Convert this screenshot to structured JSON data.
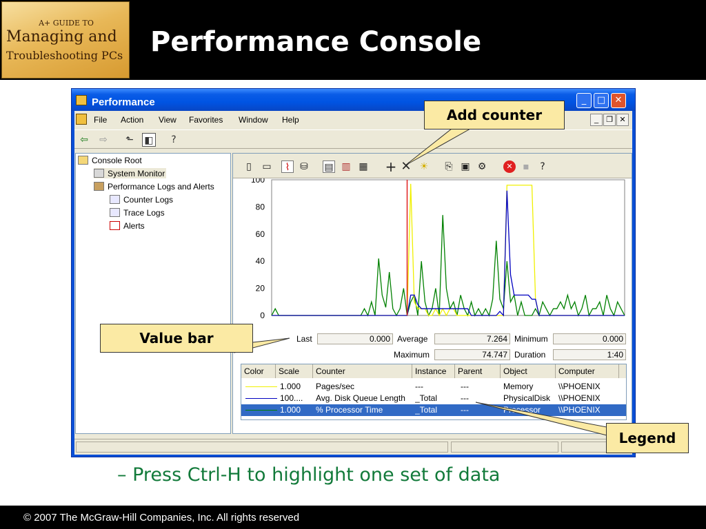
{
  "slide": {
    "title": "Performance Console",
    "logo": {
      "line1": "A+ GUIDE TO",
      "line2": "Managing and",
      "line3": "Troubleshooting PCs"
    },
    "bullet": "– Press Ctrl-H to highlight one set of data",
    "footer": "© 2007 The McGraw-Hill Companies, Inc. All rights reserved"
  },
  "window": {
    "title": "Performance",
    "menu": [
      "File",
      "Action",
      "View",
      "Favorites",
      "Window",
      "Help"
    ]
  },
  "tree": {
    "items": [
      {
        "label": "Console Root",
        "icon": "folder-icon"
      },
      {
        "label": "System Monitor",
        "icon": "monitor-icon"
      },
      {
        "label": "Performance Logs and Alerts",
        "icon": "logs-icon"
      },
      {
        "label": "Counter Logs",
        "icon": "counter-log-icon"
      },
      {
        "label": "Trace Logs",
        "icon": "trace-log-icon"
      },
      {
        "label": "Alerts",
        "icon": "alert-icon"
      }
    ]
  },
  "value_bar": {
    "last_label": "Last",
    "last": "0.000",
    "average_label": "Average",
    "average": "7.264",
    "minimum_label": "Minimum",
    "minimum": "0.000",
    "maximum_label": "Maximum",
    "maximum": "74.747",
    "duration_label": "Duration",
    "duration": "1:40"
  },
  "legend": {
    "columns": [
      "Color",
      "Scale",
      "Counter",
      "Instance",
      "Parent",
      "Object",
      "Computer"
    ],
    "rows": [
      {
        "color": "#f0f000",
        "scale": "1.000",
        "counter": "Pages/sec",
        "instance": "---",
        "parent": "---",
        "object": "Memory",
        "computer": "\\\\PHOENIX"
      },
      {
        "color": "#0000c0",
        "scale": "100....",
        "counter": "Avg. Disk Queue Length",
        "instance": "_Total",
        "parent": "---",
        "object": "PhysicalDisk",
        "computer": "\\\\PHOENIX"
      },
      {
        "color": "#008000",
        "scale": "1.000",
        "counter": "% Processor Time",
        "instance": "_Total",
        "parent": "---",
        "object": "Processor",
        "computer": "\\\\PHOENIX"
      }
    ]
  },
  "callouts": {
    "add_counter": "Add counter",
    "value_bar": "Value bar",
    "legend": "Legend"
  },
  "chart_data": {
    "type": "line",
    "ylim": [
      0,
      100
    ],
    "yticks": [
      0,
      20,
      40,
      60,
      80,
      100
    ],
    "x": [
      0,
      1,
      2,
      3,
      4,
      5,
      6,
      7,
      8,
      9,
      10,
      11,
      12,
      13,
      14,
      15,
      16,
      17,
      18,
      19,
      20,
      21,
      22,
      23,
      24,
      25,
      26,
      27,
      28,
      29,
      30,
      31,
      32,
      33,
      34,
      35,
      36,
      37,
      38,
      39,
      40,
      41,
      42,
      43,
      44,
      45,
      46,
      47,
      48,
      49,
      50,
      51,
      52,
      53,
      54,
      55,
      56,
      57,
      58,
      59,
      60,
      61,
      62,
      63,
      64,
      65,
      66,
      67,
      68,
      69,
      70,
      71,
      72,
      73,
      74,
      75,
      76,
      77,
      78,
      79,
      80,
      81,
      82,
      83,
      84,
      85,
      86,
      87,
      88,
      89,
      90,
      91,
      92,
      93,
      94,
      95,
      96,
      97,
      98,
      99
    ],
    "current_x": 38,
    "series": [
      {
        "color": "#008000",
        "values": [
          0,
          5,
          0,
          0,
          0,
          0,
          0,
          0,
          0,
          0,
          0,
          0,
          0,
          0,
          0,
          0,
          0,
          0,
          0,
          0,
          0,
          0,
          0,
          0,
          0,
          0,
          5,
          0,
          10,
          0,
          42,
          15,
          6,
          32,
          5,
          0,
          5,
          20,
          0,
          10,
          15,
          0,
          40,
          10,
          0,
          5,
          20,
          0,
          74,
          20,
          5,
          10,
          0,
          15,
          5,
          0,
          10,
          0,
          5,
          0,
          5,
          0,
          12,
          55,
          12,
          5,
          40,
          10,
          15,
          0,
          10,
          0,
          0,
          0,
          5,
          0,
          10,
          5,
          0,
          5,
          5,
          10,
          5,
          15,
          5,
          10,
          0,
          5,
          15,
          0,
          5,
          5,
          10,
          0,
          15,
          5,
          0,
          10,
          5,
          0
        ]
      },
      {
        "color": "#f0f000",
        "values": [
          0,
          0,
          0,
          0,
          0,
          0,
          0,
          0,
          0,
          0,
          0,
          0,
          0,
          0,
          0,
          0,
          0,
          0,
          0,
          0,
          0,
          0,
          0,
          0,
          0,
          0,
          0,
          0,
          0,
          0,
          0,
          0,
          0,
          0,
          0,
          0,
          0,
          0,
          0,
          97,
          10,
          5,
          5,
          5,
          0,
          0,
          5,
          0,
          5,
          0,
          5,
          5,
          0,
          0,
          0,
          0,
          0,
          0,
          0,
          0,
          0,
          0,
          0,
          0,
          0,
          0,
          96,
          96,
          96,
          96,
          96,
          96,
          96,
          96,
          12,
          0,
          0,
          0,
          0,
          0,
          0,
          0,
          0,
          0,
          0,
          0,
          0,
          0,
          0,
          0,
          0,
          0,
          0,
          0,
          0,
          0,
          0,
          0,
          0,
          0
        ]
      },
      {
        "color": "#0000c0",
        "values": [
          0,
          0,
          0,
          0,
          0,
          0,
          0,
          0,
          0,
          0,
          0,
          0,
          0,
          0,
          0,
          0,
          0,
          0,
          0,
          0,
          0,
          0,
          0,
          0,
          0,
          0,
          0,
          0,
          0,
          0,
          0,
          0,
          0,
          0,
          0,
          0,
          0,
          0,
          0,
          15,
          15,
          8,
          5,
          5,
          5,
          5,
          5,
          5,
          5,
          5,
          5,
          5,
          5,
          5,
          5,
          5,
          0,
          0,
          0,
          0,
          0,
          0,
          0,
          0,
          3,
          0,
          92,
          30,
          15,
          15,
          15,
          15,
          15,
          12,
          12,
          0,
          0,
          0,
          0,
          0,
          0,
          0,
          0,
          0,
          0,
          0,
          0,
          0,
          0,
          0,
          0,
          0,
          0,
          0,
          0,
          0,
          0,
          0,
          0,
          0
        ]
      }
    ]
  }
}
